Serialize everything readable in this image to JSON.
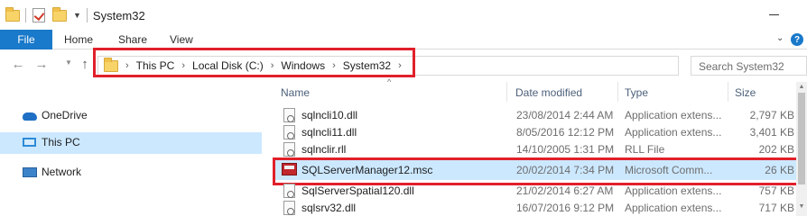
{
  "window": {
    "title": "System32"
  },
  "ribbon": {
    "tabs": [
      {
        "label": "File"
      },
      {
        "label": "Home"
      },
      {
        "label": "Share"
      },
      {
        "label": "View"
      }
    ],
    "help_label": "?"
  },
  "address_bar": {
    "breadcrumb": [
      "This PC",
      "Local Disk (C:)",
      "Windows",
      "System32"
    ],
    "separator": "›"
  },
  "search": {
    "placeholder": "Search System32"
  },
  "nav_pane": {
    "items": [
      {
        "label": "OneDrive",
        "icon": "onedrive-icon",
        "selected": false
      },
      {
        "label": "This PC",
        "icon": "this-pc-icon",
        "selected": true
      },
      {
        "label": "Network",
        "icon": "network-icon",
        "selected": false
      }
    ]
  },
  "file_list": {
    "columns": [
      "Name",
      "Date modified",
      "Type",
      "Size"
    ],
    "rows": [
      {
        "name": "sqlncli10.dll",
        "date": "23/08/2014 2:44 AM",
        "type": "Application extens...",
        "size": "2,797 KB",
        "icon": "dll-file-icon",
        "selected": false
      },
      {
        "name": "sqlncli11.dll",
        "date": "8/05/2016 12:12 PM",
        "type": "Application extens...",
        "size": "3,401 KB",
        "icon": "dll-file-icon",
        "selected": false
      },
      {
        "name": "sqlnclir.rll",
        "date": "14/10/2005 1:31 PM",
        "type": "RLL File",
        "size": "202 KB",
        "icon": "rll-file-icon",
        "selected": false
      },
      {
        "name": "SQLServerManager12.msc",
        "date": "20/02/2014 7:34 PM",
        "type": "Microsoft Comm...",
        "size": "26 KB",
        "icon": "msc-file-icon",
        "selected": true
      },
      {
        "name": "SqlServerSpatial120.dll",
        "date": "21/02/2014 6:27 AM",
        "type": "Application extens...",
        "size": "757 KB",
        "icon": "dll-file-icon",
        "selected": false
      },
      {
        "name": "sqlsrv32.dll",
        "date": "16/07/2016 9:12 PM",
        "type": "Application extens...",
        "size": "717 KB",
        "icon": "dll-file-icon",
        "selected": false
      }
    ]
  },
  "colors": {
    "accent": "#1979ca",
    "selection": "#cce8ff",
    "annotation_highlight": "#e0202a"
  }
}
